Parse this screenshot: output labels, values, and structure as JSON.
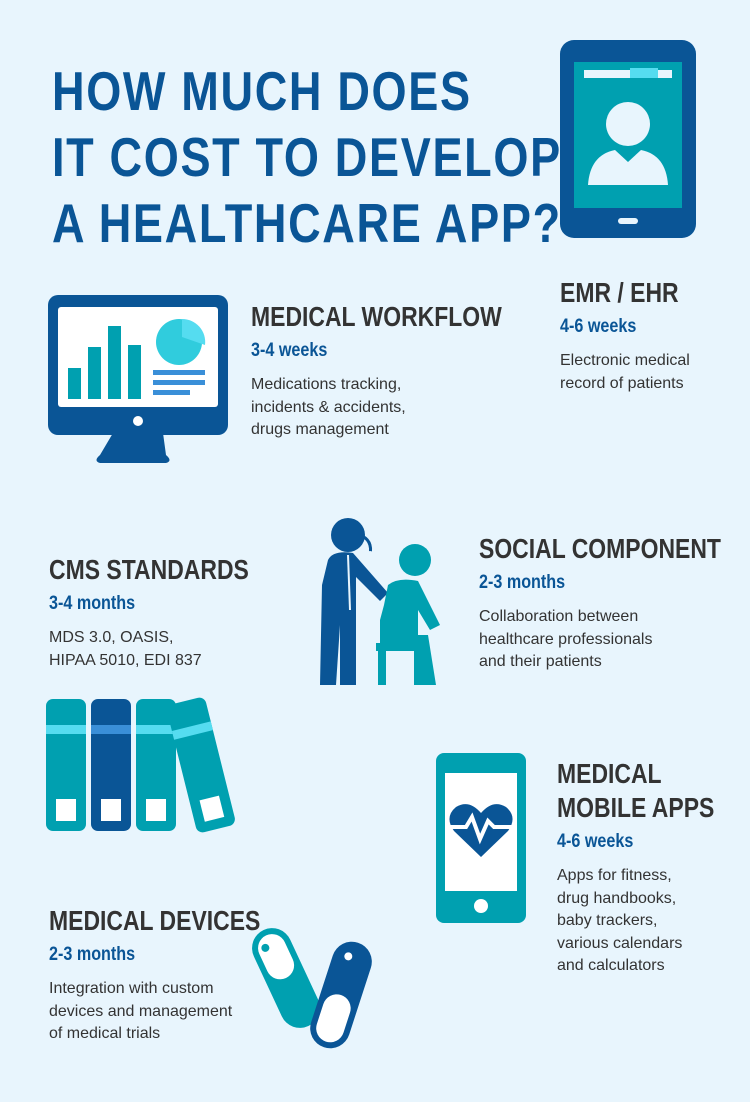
{
  "title": {
    "lines": [
      "HOW MUCH DOES",
      "IT COST TO DEVELOP",
      "A HEALTHCARE APP?"
    ]
  },
  "colors": {
    "background": "#e8f5fd",
    "dark_blue": "#0a5596",
    "teal": "#00a0b0",
    "cyan": "#55dcf0",
    "text": "#333333"
  },
  "sections": {
    "emr": {
      "heading": "EMR / EHR",
      "duration": "4-6 weeks",
      "description": [
        "Electronic medical",
        "record of patients"
      ],
      "icon": "tablet-doctor-icon"
    },
    "workflow": {
      "heading": "MEDICAL WORKFLOW",
      "duration": "3-4 weeks",
      "description": [
        "Medications tracking,",
        "incidents & accidents,",
        "drugs management"
      ],
      "icon": "monitor-chart-icon"
    },
    "cms": {
      "heading": "CMS STANDARDS",
      "duration": "3-4 months",
      "description": [
        "MDS 3.0, OASIS,",
        "HIPAA 5010, EDI 837"
      ],
      "icon": "binders-icon"
    },
    "social": {
      "heading": "SOCIAL COMPONENT",
      "duration": "2-3 months",
      "description": [
        "Collaboration between",
        "healthcare professionals",
        "and their patients"
      ],
      "icon": "doctor-patient-icon"
    },
    "mobile": {
      "heading": [
        "MEDICAL",
        "MOBILE APPS"
      ],
      "duration": "4-6 weeks",
      "description": [
        "Apps for fitness,",
        "drug handbooks,",
        "baby trackers,",
        "various calendars",
        "and calculators"
      ],
      "icon": "phone-heart-icon"
    },
    "devices": {
      "heading": "MEDICAL DEVICES",
      "duration": "2-3 months",
      "description": [
        "Integration with custom",
        "devices and management",
        "of medical trials"
      ],
      "icon": "pills-icon"
    }
  }
}
